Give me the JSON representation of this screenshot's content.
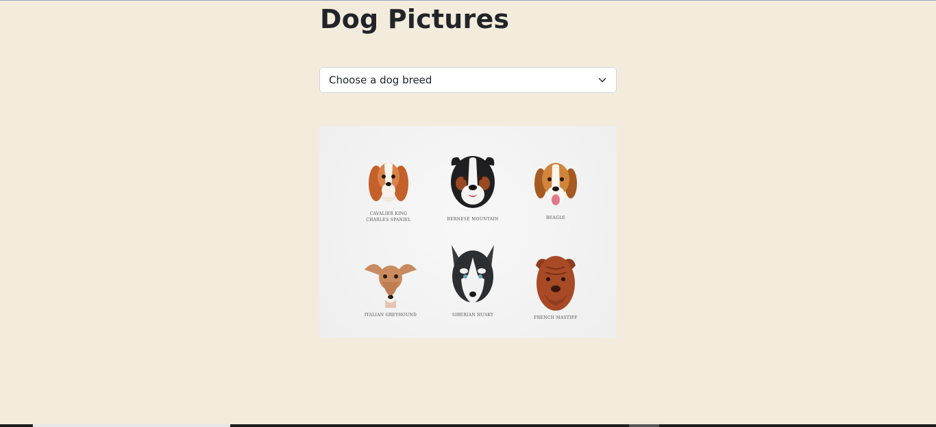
{
  "page": {
    "title": "Dog Pictures"
  },
  "breed_select": {
    "selected": "Choose a dog breed"
  },
  "image": {
    "dogs": [
      {
        "caption": "CAVALIER KING\nCHARLES SPANIEL",
        "icon": "cavalier-dog-icon"
      },
      {
        "caption": "BERNESE MOUNTAIN",
        "icon": "bernese-dog-icon"
      },
      {
        "caption": "BEAGLE",
        "icon": "beagle-dog-icon"
      },
      {
        "caption": "ITALIAN GREYHOUND",
        "icon": "greyhound-dog-icon"
      },
      {
        "caption": "SIBERIAN HUSKY",
        "icon": "husky-dog-icon"
      },
      {
        "caption": "FRENCH MASTIFF",
        "icon": "mastiff-dog-icon"
      }
    ]
  },
  "colors": {
    "background": "#f3ecdc",
    "text": "#212529",
    "select_border": "#ced4da"
  }
}
